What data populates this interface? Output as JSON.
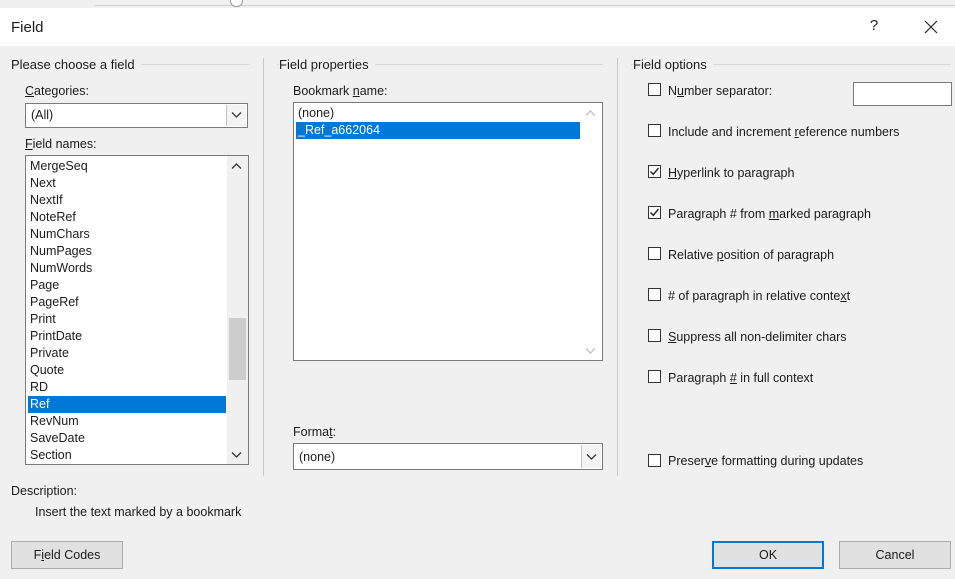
{
  "window": {
    "title": "Field",
    "help_glyph": "?",
    "close_glyph": "✕"
  },
  "left_group": {
    "title": "Please choose a field",
    "categories_label_u": "C",
    "categories_label_rest": "ategories:",
    "categories_value": "(All)",
    "field_names_label_u": "F",
    "field_names_label_rest": "ield names:",
    "field_names": [
      "MergeSeq",
      "Next",
      "NextIf",
      "NoteRef",
      "NumChars",
      "NumPages",
      "NumWords",
      "Page",
      "PageRef",
      "Print",
      "PrintDate",
      "Private",
      "Quote",
      "RD",
      "Ref",
      "RevNum",
      "SaveDate",
      "Section"
    ],
    "selected_field": "Ref"
  },
  "middle_group": {
    "title": "Field properties",
    "bookmark_label_a": "Bookmark ",
    "bookmark_label_u": "n",
    "bookmark_label_b": "ame:",
    "bookmarks": [
      "(none)",
      "_Ref_a662064"
    ],
    "selected_bookmark": "_Ref_a662064",
    "format_label_a": "Forma",
    "format_label_u": "t",
    "format_label_b": ":",
    "format_value": "(none)"
  },
  "right_group": {
    "title": "Field options",
    "options": [
      {
        "pre": "N",
        "u": "u",
        "post": "mber separator:",
        "checked": false
      },
      {
        "pre": "Include and increment ",
        "u": "r",
        "post": "eference numbers",
        "checked": false
      },
      {
        "pre": "",
        "u": "H",
        "post": "yperlink to paragraph",
        "checked": true
      },
      {
        "pre": "Paragraph # from ",
        "u": "m",
        "post": "arked paragraph",
        "checked": true
      },
      {
        "pre": "Relative ",
        "u": "p",
        "post": "osition of paragraph",
        "checked": false
      },
      {
        "pre": "# of paragraph in relative conte",
        "u": "x",
        "post": "t",
        "checked": false
      },
      {
        "pre": "",
        "u": "S",
        "post": "uppress all non-delimiter chars",
        "checked": false
      },
      {
        "pre": "Paragraph ",
        "u": "#",
        "post": " in full context",
        "checked": false
      }
    ],
    "number_separator_value": "",
    "preserve": {
      "pre": "Preser",
      "u": "v",
      "post": "e formatting during updates",
      "checked": false
    }
  },
  "description": {
    "label": "Description:",
    "text": "Insert the text marked by a bookmark"
  },
  "buttons": {
    "field_codes_pre": "F",
    "field_codes_u": "i",
    "field_codes_post": "eld Codes",
    "ok": "OK",
    "cancel": "Cancel"
  }
}
